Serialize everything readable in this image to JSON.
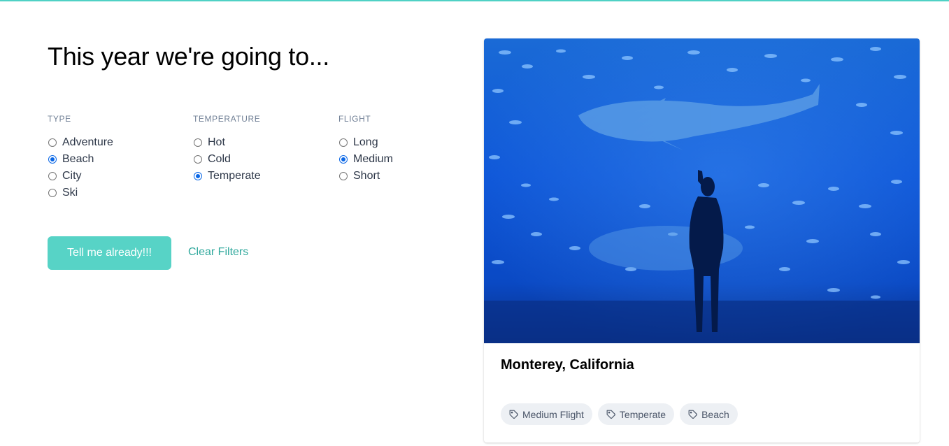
{
  "page": {
    "heading": "This year we're going to..."
  },
  "filters": {
    "groups": [
      {
        "label": "TYPE",
        "options": [
          {
            "label": "Adventure",
            "checked": false
          },
          {
            "label": "Beach",
            "checked": true
          },
          {
            "label": "City",
            "checked": false
          },
          {
            "label": "Ski",
            "checked": false
          }
        ]
      },
      {
        "label": "TEMPERATURE",
        "options": [
          {
            "label": "Hot",
            "checked": false
          },
          {
            "label": "Cold",
            "checked": false
          },
          {
            "label": "Temperate",
            "checked": true
          }
        ]
      },
      {
        "label": "FLIGHT",
        "options": [
          {
            "label": "Long",
            "checked": false
          },
          {
            "label": "Medium",
            "checked": true
          },
          {
            "label": "Short",
            "checked": false
          }
        ]
      }
    ]
  },
  "actions": {
    "submit_label": "Tell me already!!!",
    "clear_label": "Clear Filters"
  },
  "result": {
    "title": "Monterey, California",
    "tags": [
      "Medium Flight",
      "Temperate",
      "Beach"
    ]
  },
  "colors": {
    "accent": "#4fd1c5",
    "button": "#57d3c6",
    "link": "#31a99d",
    "radio_checked": "#0a67e6",
    "tag_bg": "#edf0f4"
  },
  "icons": {
    "tag": "tag-icon"
  }
}
